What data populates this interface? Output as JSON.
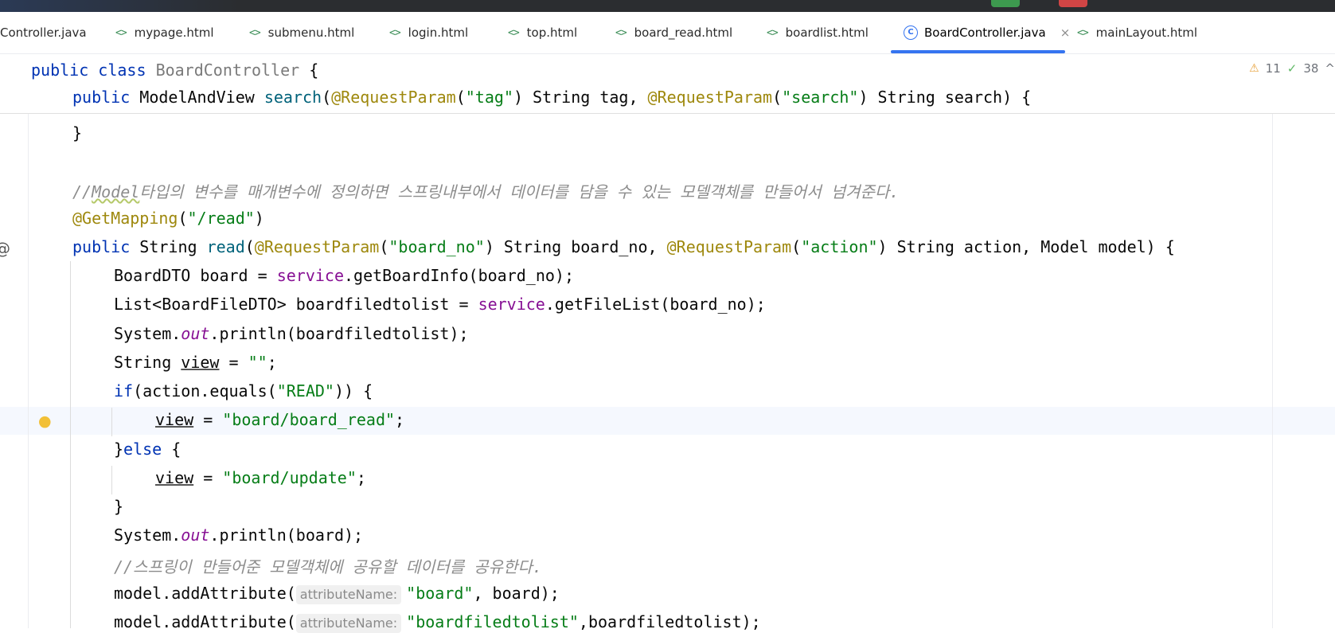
{
  "tabs": [
    {
      "label": "Controller.java",
      "icon": "java-file-icon"
    },
    {
      "label": "mypage.html",
      "icon": "html-file-icon"
    },
    {
      "label": "submenu.html",
      "icon": "html-file-icon"
    },
    {
      "label": "login.html",
      "icon": "html-file-icon"
    },
    {
      "label": "top.html",
      "icon": "html-file-icon"
    },
    {
      "label": "board_read.html",
      "icon": "html-file-icon"
    },
    {
      "label": "boardlist.html",
      "icon": "html-file-icon"
    },
    {
      "label": "BoardController.java",
      "icon": "java-class-icon",
      "active": true,
      "close": "×"
    },
    {
      "label": "mainLayout.html",
      "icon": "html-file-icon"
    }
  ],
  "html_icon_glyph": "<>",
  "class_icon_glyph": "C",
  "inspections": {
    "warnings": "11",
    "ok": "38",
    "warn_glyph": "⚠",
    "ok_glyph": "✓",
    "expand_glyph": "^"
  },
  "sticky": {
    "line1": {
      "kw1": "public",
      "kw2": "class",
      "name": "BoardController",
      "brace": " {"
    },
    "line2": {
      "kw1": "public",
      "type": "ModelAndView",
      "fn": "search",
      "ann1": "@RequestParam",
      "arg1": "\"tag\"",
      "p1": " String tag, ",
      "ann2": "@RequestParam",
      "arg2": "\"search\"",
      "p2": " String search) {"
    }
  },
  "code": {
    "l_close": "}",
    "comment1_a": "//",
    "comment1_b": "Model",
    "comment1_c": "타입의 변수를 매개변수에 정의하면 스프링내부에서 데이터를 담을 수 있는 모델객체를 만들어서 넘겨준다.",
    "getmapping": "@GetMapping",
    "getmapping_arg": "\"/read\"",
    "read_kw": "public",
    "read_type": " String ",
    "read_fn": "read",
    "read_ann1": "@RequestParam",
    "read_arg1": "\"board_no\"",
    "read_p1": " String board_no, ",
    "read_ann2": "@RequestParam",
    "read_arg2": "\"action\"",
    "read_p2": " String action, Model model) {",
    "l1_a": "BoardDTO board = ",
    "l1_b": "service",
    "l1_c": ".getBoardInfo(board_no);",
    "l2_a": "List<BoardFileDTO> boardfiledtolist = ",
    "l2_b": "service",
    "l2_c": ".getFileList(board_no);",
    "l3_a": "System.",
    "l3_b": "out",
    "l3_c": ".println(boardfiledtolist);",
    "l4_a": "String ",
    "l4_b": "view",
    "l4_c": " = ",
    "l4_d": "\"\"",
    "l4_e": ";",
    "l5_kw": "if",
    "l5_a": "(action.equals(",
    "l5_b": "\"READ\"",
    "l5_c": ")) {",
    "l6_a": "view",
    "l6_b": " = ",
    "l6_c": "\"board/board_read\"",
    "l6_d": ";",
    "l7_a": "}",
    "l7_kw": "else",
    "l7_b": " {",
    "l8_a": "view",
    "l8_b": " = ",
    "l8_c": "\"board/update\"",
    "l8_d": ";",
    "l9": "}",
    "l10_a": "System.",
    "l10_b": "out",
    "l10_c": ".println(board);",
    "comment2": "//스프링이 만들어준 모델객체에 공유할 데이터를 공유한다.",
    "l11_a": "model.addAttribute(",
    "l11_hint": "attributeName:",
    "l11_b": "\"board\"",
    "l11_c": ", board);",
    "l12_a": "model.addAttribute(",
    "l12_hint": "attributeName:",
    "l12_b": "\"boardfiledtolist\"",
    "l12_c": ",boardfiledtolist);"
  }
}
